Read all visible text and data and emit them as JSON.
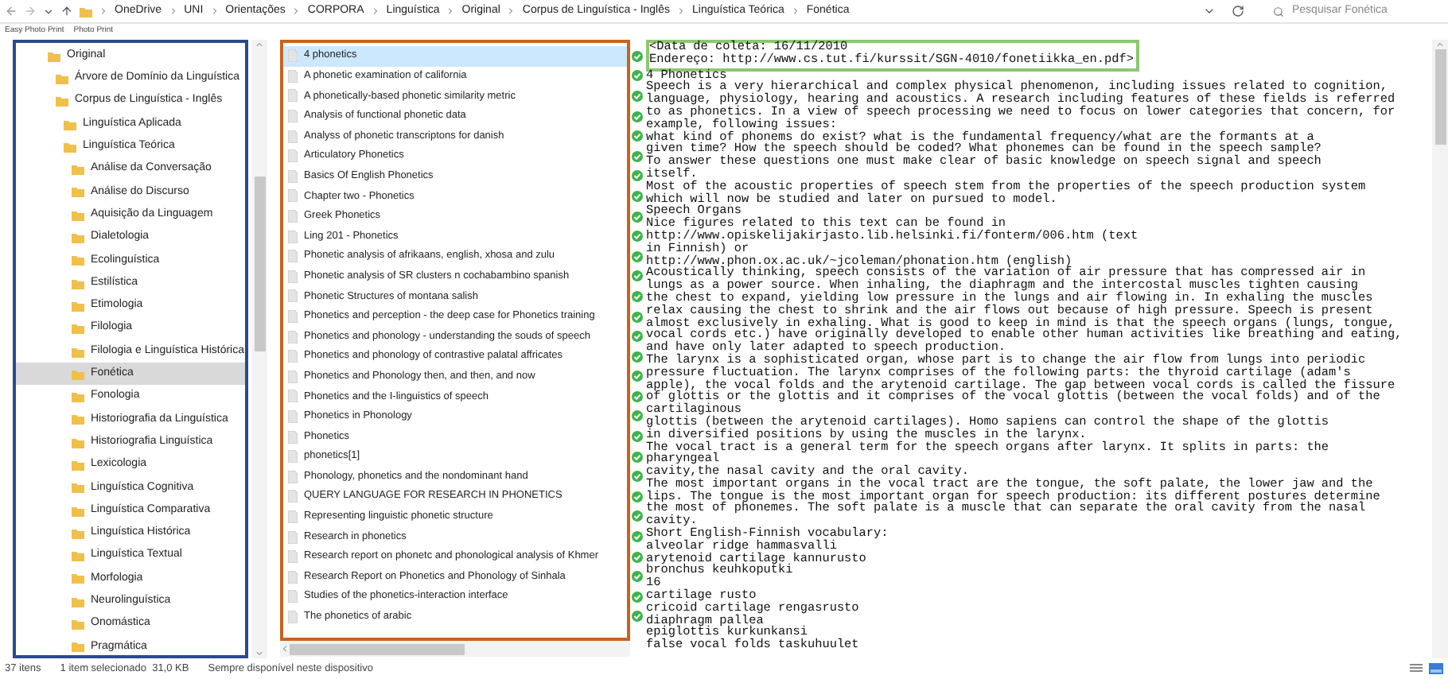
{
  "address_bar": {
    "path": [
      "OneDrive",
      "UNI",
      "Orientações",
      "CORPORA",
      "Linguística",
      "Original",
      "Corpus de Linguística - Inglês",
      "Linguística Teórica",
      "Fonética"
    ],
    "search": {
      "placeholder": "Pesquisar Fonética"
    }
  },
  "toolbar": {
    "items": [
      "Easy Photo Print",
      "Photo Print"
    ]
  },
  "folder_tree": [
    {
      "label": "Original",
      "selected": false,
      "children": [
        {
          "label": "Árvore de Domínio da Linguística",
          "selected": false
        },
        {
          "label": "Corpus de Linguística - Inglês",
          "selected": false,
          "children": [
            {
              "label": "Linguística Aplicada",
              "selected": false
            },
            {
              "label": "Linguística Teórica",
              "selected": false,
              "children": [
                {
                  "label": "Análise da Conversação",
                  "selected": false
                },
                {
                  "label": "Análise do Discurso",
                  "selected": false
                },
                {
                  "label": "Aquisição da Linguagem",
                  "selected": false
                },
                {
                  "label": "Dialetologia",
                  "selected": false
                },
                {
                  "label": "Ecolinguística",
                  "selected": false
                },
                {
                  "label": "Estilística",
                  "selected": false
                },
                {
                  "label": "Etimologia",
                  "selected": false
                },
                {
                  "label": "Filologia",
                  "selected": false
                },
                {
                  "label": "Filologia e Linguística Histórica",
                  "selected": false
                },
                {
                  "label": "Fonética",
                  "selected": true
                },
                {
                  "label": "Fonologia",
                  "selected": false
                },
                {
                  "label": "Historiografia da Linguística",
                  "selected": false
                },
                {
                  "label": "Historiografia Linguística",
                  "selected": false
                },
                {
                  "label": "Lexicologia",
                  "selected": false
                },
                {
                  "label": "Linguística Cognitiva",
                  "selected": false
                },
                {
                  "label": "Linguística Comparativa",
                  "selected": false
                },
                {
                  "label": "Linguística Histórica",
                  "selected": false
                },
                {
                  "label": "Linguística Textual",
                  "selected": false
                },
                {
                  "label": "Morfologia",
                  "selected": false
                },
                {
                  "label": "Neurolinguística",
                  "selected": false
                },
                {
                  "label": "Onomástica",
                  "selected": false
                },
                {
                  "label": "Pragmática",
                  "selected": false
                }
              ]
            }
          ]
        }
      ]
    }
  ],
  "files": [
    {
      "name": "4 phonetics",
      "selected": true
    },
    {
      "name": "A phonetic examination of california",
      "selected": false
    },
    {
      "name": "A phonetically-based phonetic similarity metric",
      "selected": false
    },
    {
      "name": "Analysis of functional phonetic data",
      "selected": false
    },
    {
      "name": "Analyss of phonetic transcriptons for danish",
      "selected": false
    },
    {
      "name": "Articulatory Phonetics",
      "selected": false
    },
    {
      "name": "Basics Of English Phonetics",
      "selected": false
    },
    {
      "name": "Chapter two - Phonetics",
      "selected": false
    },
    {
      "name": "Greek Phonetics",
      "selected": false
    },
    {
      "name": "Ling 201 - Phonetics",
      "selected": false
    },
    {
      "name": "Phonetic analysis of afrikaans, english, xhosa and zulu",
      "selected": false
    },
    {
      "name": "Phonetic analysis of SR clusters n cochabambino spanish",
      "selected": false
    },
    {
      "name": "Phonetic Structures of montana salish",
      "selected": false
    },
    {
      "name": "Phonetics and perception - the deep case for Phonetics training",
      "selected": false
    },
    {
      "name": "Phonetics and phonology - understanding the souds of speech",
      "selected": false
    },
    {
      "name": "Phonetics and phonology of contrastive palatal affricates",
      "selected": false
    },
    {
      "name": "Phonetics and Phonology then, and then, and now",
      "selected": false
    },
    {
      "name": "Phonetics and the I-linguistics of speech",
      "selected": false
    },
    {
      "name": "Phonetics in Phonology",
      "selected": false
    },
    {
      "name": "Phonetics",
      "selected": false
    },
    {
      "name": "phonetics[1]",
      "selected": false
    },
    {
      "name": "Phonology, phonetics and the nondominant hand",
      "selected": false
    },
    {
      "name": "QUERY LANGUAGE FOR RESEARCH IN PHONETICS",
      "selected": false
    },
    {
      "name": "Representing linguistic phonetic structure",
      "selected": false
    },
    {
      "name": "Research in phonetics",
      "selected": false
    },
    {
      "name": "Research report on phonetc and phonological analysis of Khmer",
      "selected": false
    },
    {
      "name": "Research Report on Phonetics and Phonology of Sinhala",
      "selected": false
    },
    {
      "name": "Studies of the phonetics-interaction interface",
      "selected": false
    },
    {
      "name": "The phonetics of arabic",
      "selected": false
    }
  ],
  "preview": {
    "header_lines": [
      "<Data de coleta: 16/11/2010",
      "Endereço: http://www.cs.tut.fi/kurssit/SGN-4010/fonetiikka_en.pdf>"
    ],
    "body_lines": [
      "4 Phonetics",
      "Speech is a very hierarchical and complex physical phenomenon, including issues related to cognition,",
      "language, physiology, hearing and acoustics. A research including features of these fields is referred",
      "to as phonetics. In a view of speech processing we need to focus on lower categories that concern, for",
      "example, following issues:",
      "what kind of phonems do exist? what is the fundamental frequency/what are the formants at a",
      "given time? How the speech should be coded? What phonemes can be found in the speech sample?",
      "To answer these questions one must make clear of basic knowledge on speech signal and speech",
      "itself.",
      "Most of the acoustic properties of speech stem from the properties of the speech production system",
      "which will now be studied and later on pursued to model.",
      "Speech Organs",
      "Nice figures related to this text can be found in",
      "http://www.opiskelijakirjasto.lib.helsinki.fi/fonterm/006.htm (text",
      "in Finnish) or",
      "http://www.phon.ox.ac.uk/~jcoleman/phonation.htm (english)",
      "Acoustically thinking, speech consists of the variation of air pressure that has compressed air in",
      "lungs as a power source. When inhaling, the diaphragm and the intercostal muscles tighten causing",
      "the chest to expand, yielding low pressure in the lungs and air flowing in. In exhaling the muscles",
      "relax causing the chest to shrink and the air flows out because of high pressure. Speech is present",
      "almost exclusively in exhaling. What is good to keep in mind is that the speech organs (lungs, tongue,",
      "vocal cords etc.) have originally developed to enable other human activities like breathing and eating,",
      "and have only later adapted to speech production.",
      "The larynx is a sophisticated organ, whose part is to change the air flow from lungs into periodic",
      "pressure fluctuation. The larynx comprises of the following parts: the thyroid cartilage (adam's",
      "apple), the vocal folds and the arytenoid cartilage. The gap between vocal cords is called the fissure",
      "of glottis or the glottis and it comprises of the vocal glottis (between the vocal folds) and of the",
      "cartilaginous",
      "glottis (between the arytenoid cartilages). Homo sapiens can control the shape of the glottis",
      "in diversified positions by using the muscles in the larynx.",
      "The vocal tract is a general term for the speech organs after larynx. It splits in parts: the",
      "pharyngeal",
      "cavity,the nasal cavity and the oral cavity.",
      "The most important organs in the vocal tract are the tongue, the soft palate, the lower jaw and the",
      "lips. The tongue is the most important organ for speech production: its different postures determine",
      "the most of phonemes. The soft palate is a muscle that can separate the oral cavity from the nasal",
      "cavity.",
      "Short English-Finnish vocabulary:",
      "alveolar ridge hammasvalli",
      "arytenoid cartilage kannurusto",
      "bronchus keuhkoputki",
      "16",
      "cartilage rusto",
      "cricoid cartilage rengasrusto",
      "diaphragm pallea",
      "epiglottis kurkunkansi",
      "false vocal folds taskuhuulet"
    ]
  },
  "status_bar": {
    "item_count": "37 itens",
    "selection": "1 item selecionado  31,0 KB",
    "availability": "Sempre disponível neste dispositivo"
  }
}
